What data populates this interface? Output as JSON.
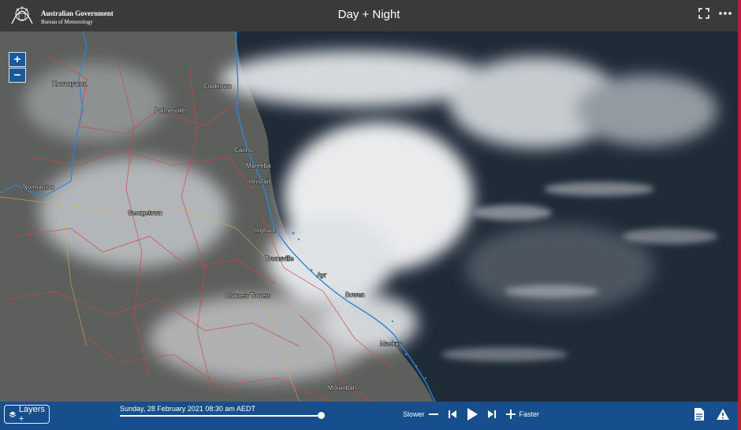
{
  "header": {
    "government": "Australian Government",
    "agency": "Bureau of Meteorology",
    "title": "Day + Night"
  },
  "icons": {
    "fullscreen": "fullscreen-icon",
    "more": "more-icon",
    "layers": "layers-icon",
    "info": "document-icon",
    "warning": "warning-icon"
  },
  "map": {
    "zoom_in": "+",
    "zoom_out": "−",
    "places": [
      {
        "name": "Kowanyama"
      },
      {
        "name": "Cooktown"
      },
      {
        "name": "Palmerville"
      },
      {
        "name": "Cairns"
      },
      {
        "name": "Mareeba"
      },
      {
        "name": "Innisfail"
      },
      {
        "name": "Normanton"
      },
      {
        "name": "Georgetown"
      },
      {
        "name": "Ingham"
      },
      {
        "name": "Townsville"
      },
      {
        "name": "Ayr"
      },
      {
        "name": "Charters Towers"
      },
      {
        "name": "Bowen"
      },
      {
        "name": "Mackay"
      },
      {
        "name": "Moranbah"
      }
    ]
  },
  "footer": {
    "layers_label": "Layers +",
    "datetime": "Sunday, 28 February 2021 08:30 am AEDT",
    "timeline_position": 0.98,
    "slower": "Slower",
    "faster": "Faster"
  },
  "colors": {
    "header_bg": "#3a3a3a",
    "footer_bg": "#164f8c",
    "coastline": "#2f84d6",
    "boundaries": "#d24444",
    "roads": "#d8b05a"
  }
}
